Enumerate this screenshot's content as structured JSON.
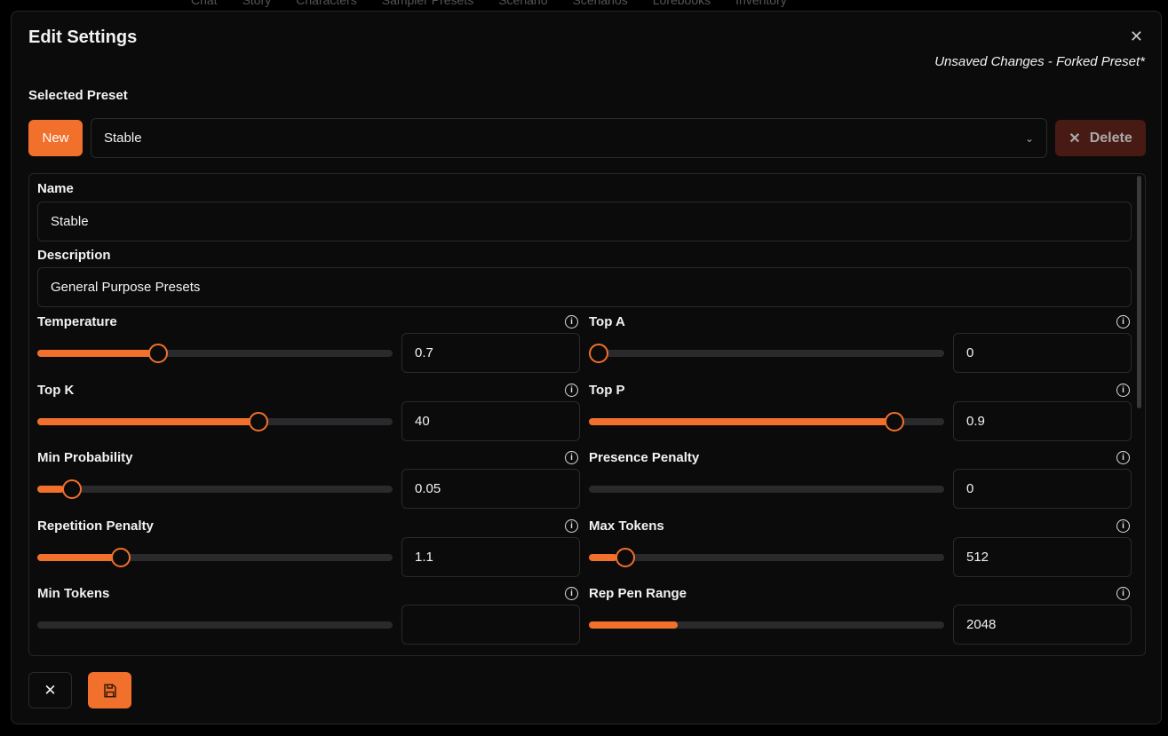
{
  "background_nav": [
    "Chat",
    "Story",
    "Characters",
    "Sampler Presets",
    "Scenario",
    "Scenarios",
    "Lorebooks",
    "Inventory"
  ],
  "modal": {
    "title": "Edit Settings",
    "status": "Unsaved Changes - Forked Preset*",
    "selected_preset_label": "Selected Preset",
    "new_label": "New",
    "selected_preset": "Stable",
    "delete_label": "Delete"
  },
  "form": {
    "name_label": "Name",
    "name_value": "Stable",
    "description_label": "Description",
    "description_value": "General Purpose Presets"
  },
  "sliders": [
    {
      "label": "Temperature",
      "value": "0.7",
      "percent": 33,
      "thumb": true
    },
    {
      "label": "Top A",
      "value": "0",
      "percent": 0,
      "thumb": true
    },
    {
      "label": "Top K",
      "value": "40",
      "percent": 63,
      "thumb": true
    },
    {
      "label": "Top P",
      "value": "0.9",
      "percent": 88,
      "thumb": true
    },
    {
      "label": "Min Probability",
      "value": "0.05",
      "percent": 7.5,
      "thumb": true
    },
    {
      "label": "Presence Penalty",
      "value": "0",
      "percent": 0,
      "thumb": false
    },
    {
      "label": "Repetition Penalty",
      "value": "1.1",
      "percent": 22,
      "thumb": true
    },
    {
      "label": "Max Tokens",
      "value": "512",
      "percent": 8,
      "thumb": true
    },
    {
      "label": "Min Tokens",
      "value": "",
      "percent": 0,
      "thumb": false
    },
    {
      "label": "Rep Pen Range",
      "value": "2048",
      "percent": 25,
      "thumb": false
    }
  ],
  "colors": {
    "accent": "#f0702c",
    "delete_bg": "#471a14",
    "background": "#0c0b0b"
  }
}
